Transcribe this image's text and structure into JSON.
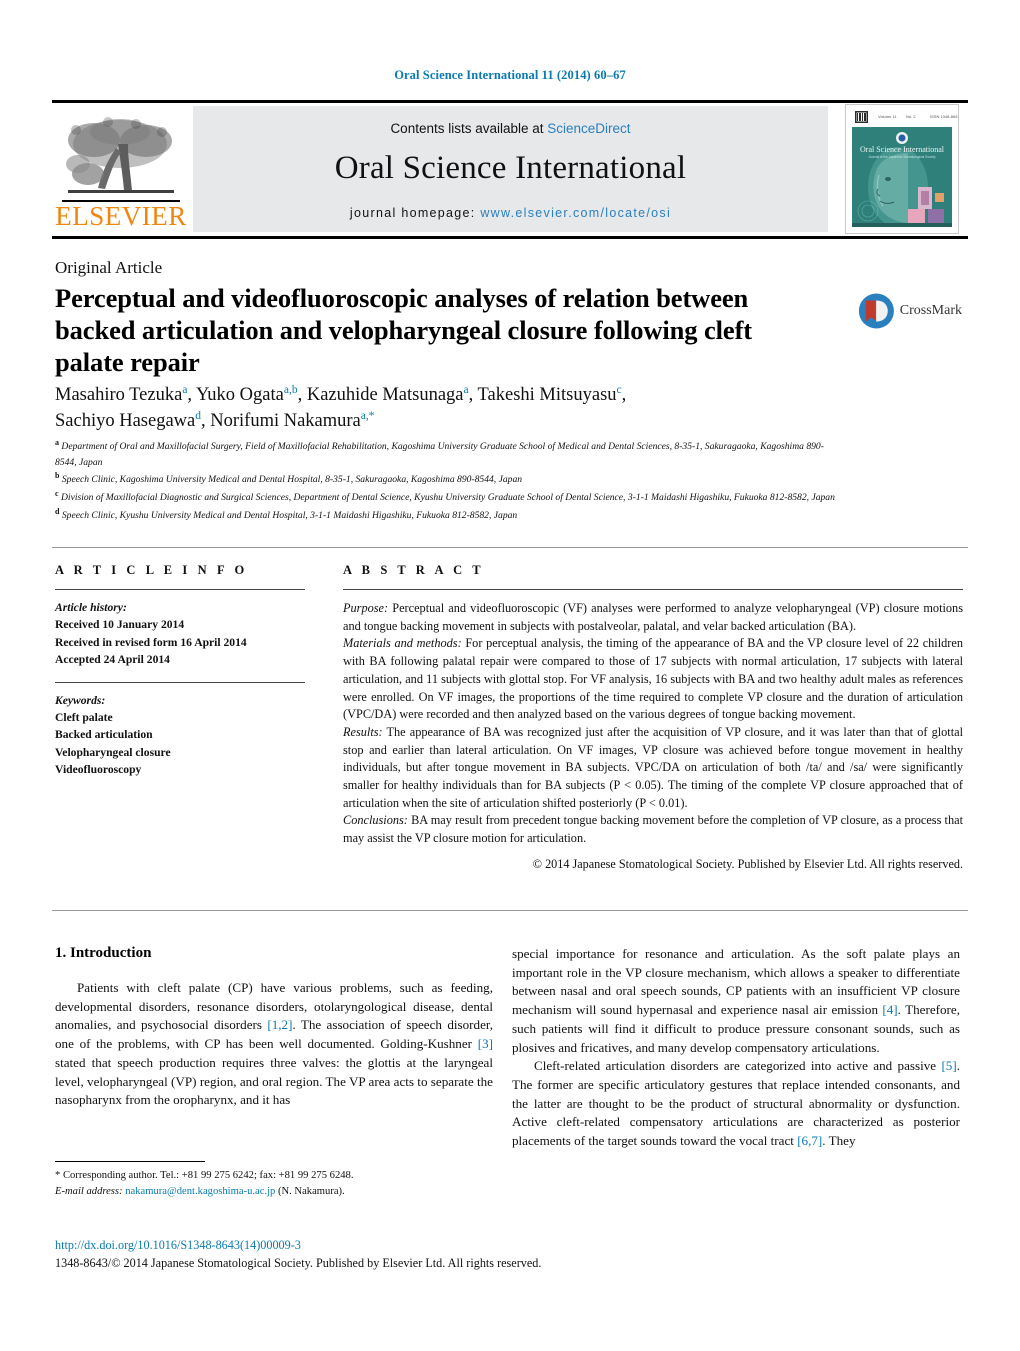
{
  "running_head": "Oral Science International 11 (2014) 60–67",
  "masthead": {
    "contents_prefix": "Contents lists available at ",
    "sciencedirect": "ScienceDirect",
    "journal_name": "Oral Science International",
    "homepage_prefix": "journal homepage: ",
    "homepage_url": "www.elsevier.com/locate/osi",
    "publisher_logo_text": "ELSEVIER",
    "cover_title": "Oral Science International",
    "accent_blue": "#2a7fbf",
    "elsevier_orange": "#f0860e",
    "band_gray": "#e7e8e9",
    "cover_teal": "#2f7f7a"
  },
  "article": {
    "type_label": "Original Article",
    "title": "Perceptual and videofluoroscopic analyses of relation between backed articulation and velopharyngeal closure following cleft palate repair",
    "crossmark_label": "CrossMark",
    "authors_line1_html": "Masahiro Tezuka<sup>a</sup>, Yuko Ogata<sup>a,b</sup>, Kazuhide Matsunaga<sup>a</sup>, Takeshi Mitsuyasu<sup>c</sup>,",
    "authors_line2_html": "Sachiyo Hasegawa<sup>d</sup>, Norifumi Nakamura<sup>a,</sup><sup>*</sup>",
    "affiliations": [
      {
        "label": "a",
        "text": "Department of Oral and Maxillofacial Surgery, Field of Maxillofacial Rehabilitation, Kagoshima University Graduate School of Medical and Dental Sciences, 8-35-1, Sakuragaoka, Kagoshima 890-8544, Japan"
      },
      {
        "label": "b",
        "text": "Speech Clinic, Kagoshima University Medical and Dental Hospital, 8-35-1, Sakuragaoka, Kagoshima 890-8544, Japan"
      },
      {
        "label": "c",
        "text": "Division of Maxillofacial Diagnostic and Surgical Sciences, Department of Dental Science, Kyushu University Graduate School of Dental Science, 3-1-1 Maidashi Higashiku, Fukuoka 812-8582, Japan"
      },
      {
        "label": "d",
        "text": "Speech Clinic, Kyushu University Medical and Dental Hospital, 3-1-1 Maidashi Higashiku, Fukuoka 812-8582, Japan"
      }
    ]
  },
  "article_info": {
    "heading": "A R T I C L E    I N F O",
    "history_label": "Article history:",
    "history": [
      "Received 10 January 2014",
      "Received in revised form 16 April 2014",
      "Accepted 24 April 2014"
    ],
    "keywords_label": "Keywords:",
    "keywords": [
      "Cleft palate",
      "Backed articulation",
      "Velopharyngeal closure",
      "Videofluoroscopy"
    ]
  },
  "abstract": {
    "heading": "A B S T R A C T",
    "purpose_label": "Purpose:",
    "purpose_text": " Perceptual and videofluoroscopic (VF) analyses were performed to analyze velopharyngeal (VP) closure motions and tongue backing movement in subjects with postalveolar, palatal, and velar backed articulation (BA).",
    "methods_label": "Materials and methods:",
    "methods_text": " For perceptual analysis, the timing of the appearance of BA and the VP closure level of 22 children with BA following palatal repair were compared to those of 17 subjects with normal articulation, 17 subjects with lateral articulation, and 11 subjects with glottal stop. For VF analysis, 16 subjects with BA and two healthy adult males as references were enrolled. On VF images, the proportions of the time required to complete VP closure and the duration of articulation (VPC/DA) were recorded and then analyzed based on the various degrees of tongue backing movement.",
    "results_label": "Results:",
    "results_text": " The appearance of BA was recognized just after the acquisition of VP closure, and it was later than that of glottal stop and earlier than lateral articulation. On VF images, VP closure was achieved before tongue movement in healthy individuals, but after tongue movement in BA subjects. VPC/DA on articulation of both /ta/ and /sa/ were significantly smaller for healthy individuals than for BA subjects (P < 0.05). The timing of the complete VP closure approached that of articulation when the site of articulation shifted posteriorly (P < 0.01).",
    "conclusions_label": "Conclusions:",
    "conclusions_text": " BA may result from precedent tongue backing movement before the completion of VP closure, as a process that may assist the VP closure motion for articulation.",
    "copyright": "© 2014 Japanese Stomatological Society. Published by Elsevier Ltd. All rights reserved."
  },
  "body": {
    "section_number_title": "1.  Introduction",
    "left_paragraph_1_a": "Patients with cleft palate (CP) have various problems, such as feeding, developmental disorders, resonance disorders, otolaryngological disease, dental anomalies, and psychosocial disorders ",
    "left_ref_12": "[1,2]",
    "left_paragraph_1_b": ". The association of speech disorder, one of the problems, with CP has been well documented. Golding-Kushner ",
    "left_ref_3": "[3]",
    "left_paragraph_1_c": " stated that speech production requires three valves: the glottis at the laryngeal level, velopharyngeal (VP) region, and oral region. The VP area acts to separate the nasopharynx from the oropharynx, and it has",
    "right_paragraph_1_a": "special importance for resonance and articulation. As the soft palate plays an important role in the VP closure mechanism, which allows a speaker to differentiate between nasal and oral speech sounds, CP patients with an insufficient VP closure mechanism will sound hypernasal and experience nasal air emission ",
    "right_ref_4": "[4]",
    "right_paragraph_1_b": ". Therefore, such patients will find it difficult to produce pressure consonant sounds, such as plosives and fricatives, and many develop compensatory articulations.",
    "right_paragraph_2_a": "Cleft-related articulation disorders are categorized into active and passive ",
    "right_ref_5": "[5]",
    "right_paragraph_2_b": ". The former are specific articulatory gestures that replace intended consonants, and the latter are thought to be the product of structural abnormality or dysfunction. Active cleft-related compensatory articulations are characterized as posterior placements of the target sounds toward the vocal tract ",
    "right_ref_67": "[6,7]",
    "right_paragraph_2_c": ". They"
  },
  "footer": {
    "corresponding_marker": "*",
    "corresponding_text": " Corresponding author. Tel.: +81 99 275 6242; fax: +81 99 275 6248.",
    "email_label": "E-mail address:",
    "email": "nakamura@dent.kagoshima-u.ac.jp",
    "email_suffix": " (N. Nakamura).",
    "doi": "http://dx.doi.org/10.1016/S1348-8643(14)00009-3",
    "issn_line": "1348-8643/© 2014 Japanese Stomatological Society. Published by Elsevier Ltd. All rights reserved."
  }
}
